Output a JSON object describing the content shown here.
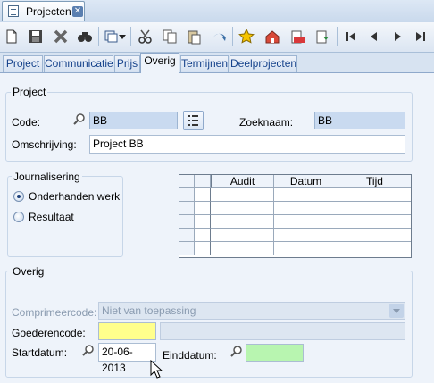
{
  "document_tab": {
    "title": "Projecten",
    "close_glyph": "✕"
  },
  "toolbar": {
    "buttons": [
      "new-icon",
      "save-icon",
      "delete-icon",
      "find-icon",
      "filter-dropdown-icon",
      "cut-icon",
      "copy-icon",
      "paste-icon",
      "undo-icon",
      "favorite-icon",
      "home-icon",
      "export-icon",
      "import-icon",
      "first-record-icon",
      "previous-record-icon",
      "next-record-icon",
      "last-record-icon"
    ]
  },
  "tabs": [
    "Project",
    "Communicatie",
    "Prijs",
    "Overig",
    "Termijnen",
    "Deelprojecten"
  ],
  "active_tab": "Overig",
  "project_group": {
    "title": "Project",
    "code_label": "Code:",
    "code_value": "BB",
    "zoeknaam_label": "Zoeknaam:",
    "zoeknaam_value": "BB",
    "omschrijving_label": "Omschrijving:",
    "omschrijving_value": "Project BB"
  },
  "journalisering": {
    "title": "Journalisering",
    "options": [
      "Onderhanden werk",
      "Resultaat"
    ],
    "selected": "Onderhanden werk"
  },
  "audit_grid": {
    "columns": [
      "Audit",
      "Datum",
      "Tijd"
    ],
    "rows": 5
  },
  "overig_group": {
    "title": "Overig",
    "comprimeercode_label": "Comprimeercode:",
    "comprimeercode_value": "Niet van toepassing",
    "goederencode_label": "Goederencode:",
    "goederencode_value": "",
    "goederencode_desc": "",
    "startdatum_label": "Startdatum:",
    "startdatum_value": "20-06-2013",
    "einddatum_label": "Einddatum:",
    "einddatum_value": ""
  },
  "colors": {
    "highlight_yellow": "#ffff8c",
    "highlight_green": "#b8f5b0",
    "readonly_blue": "#c9daf0"
  }
}
